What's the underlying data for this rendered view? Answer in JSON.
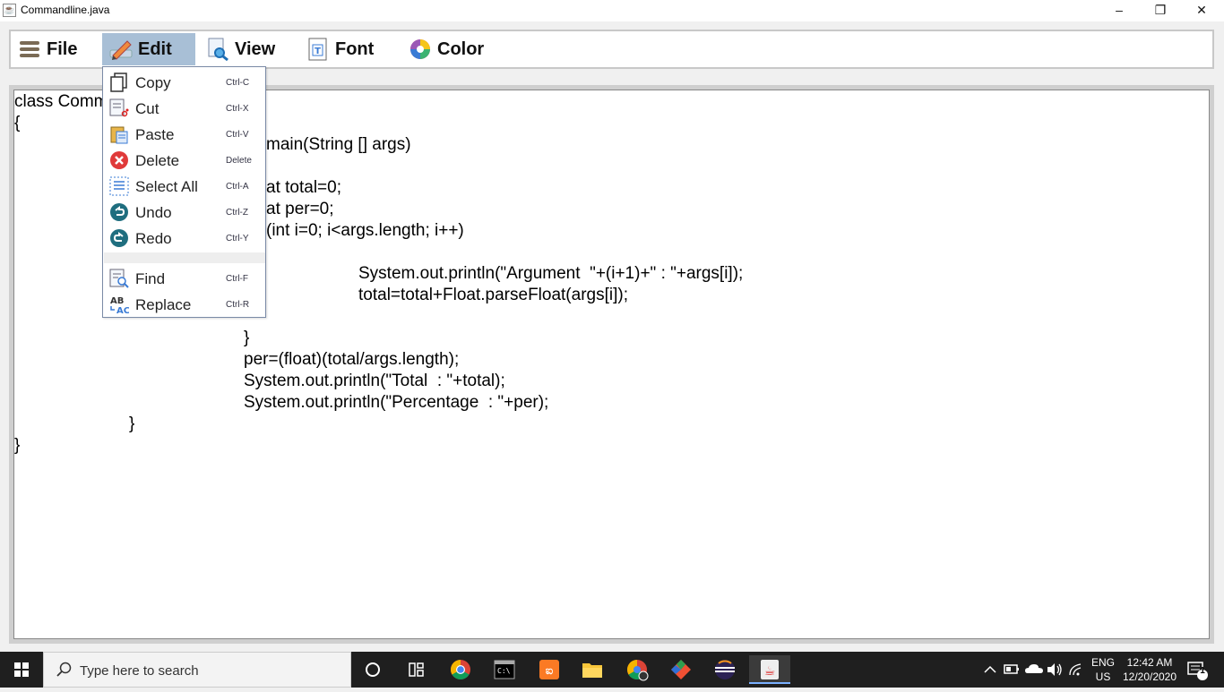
{
  "window": {
    "title": "Commandline.java",
    "min_glyph": "–",
    "max_glyph": "❐",
    "close_glyph": "✕"
  },
  "menubar": {
    "items": [
      {
        "label": "File",
        "icon": "hamburger-icon"
      },
      {
        "label": "Edit",
        "icon": "pencil-icon"
      },
      {
        "label": "View",
        "icon": "magnifier-doc-icon"
      },
      {
        "label": "Font",
        "icon": "font-doc-icon"
      },
      {
        "label": "Color",
        "icon": "color-wheel-icon"
      }
    ],
    "active": "Edit"
  },
  "edit_menu": {
    "items": [
      {
        "label": "Copy",
        "shortcut": "Ctrl-C",
        "icon": "copy-icon"
      },
      {
        "label": "Cut",
        "shortcut": "Ctrl-X",
        "icon": "cut-icon"
      },
      {
        "label": "Paste",
        "shortcut": "Ctrl-V",
        "icon": "paste-icon"
      },
      {
        "label": "Delete",
        "shortcut": "Delete",
        "icon": "delete-icon"
      },
      {
        "label": "Select All",
        "shortcut": "Ctrl-A",
        "icon": "select-all-icon"
      },
      {
        "label": "Undo",
        "shortcut": "Ctrl-Z",
        "icon": "undo-icon"
      },
      {
        "label": "Redo",
        "shortcut": "Ctrl-Y",
        "icon": "redo-icon"
      },
      {
        "label": "Find",
        "shortcut": "Ctrl-F",
        "icon": "find-icon"
      },
      {
        "label": "Replace",
        "shortcut": "Ctrl-R",
        "icon": "replace-icon"
      }
    ]
  },
  "editor": {
    "lines": [
      "class Comm",
      "{",
      "main(String [] args)",
      "at total=0;",
      "at per=0;",
      "(int i=0; i<args.length; i++)",
      "System.out.println(\"Argument  \"+(i+1)+\" : \"+args[i]);",
      "total=total+Float.parseFloat(args[i]);",
      "}",
      "per=(float)(total/args.length);",
      "System.out.println(\"Total  : \"+total);",
      "System.out.println(\"Percentage  : \"+per);",
      "}",
      "}"
    ]
  },
  "taskbar": {
    "search_placeholder": "Type here to search",
    "language": "ENG",
    "region": "US",
    "time": "12:42 AM",
    "date": "12/20/2020",
    "notification_count": "1"
  },
  "colors": {
    "accent": "#a8bfd6",
    "taskbar": "#1f1f1f"
  }
}
